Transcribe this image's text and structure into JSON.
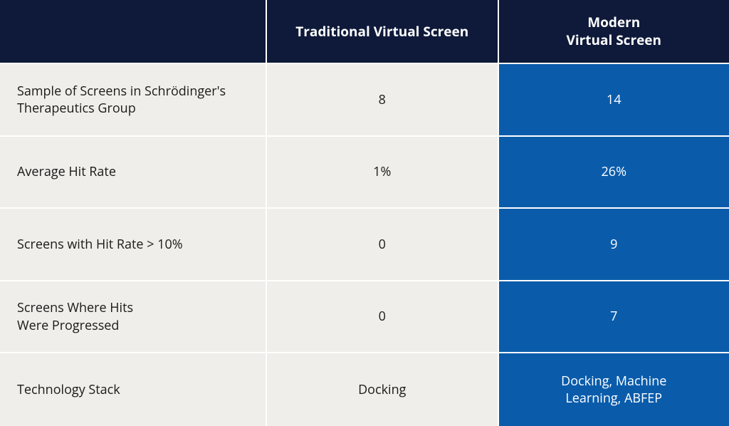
{
  "chart_data": {
    "type": "table",
    "columns": [
      "",
      "Traditional Virtual Screen",
      "Modern\nVirtual Screen"
    ],
    "rows": [
      {
        "label": "Sample of Screens in Schrödinger's Therapeutics Group",
        "traditional": "8",
        "modern": "14"
      },
      {
        "label": "Average Hit Rate",
        "traditional": "1%",
        "modern": "26%"
      },
      {
        "label": "Screens with Hit Rate > 10%",
        "traditional": "0",
        "modern": "9"
      },
      {
        "label": "Screens Where Hits\nWere Progressed",
        "traditional": "0",
        "modern": "7"
      },
      {
        "label": "Technology Stack",
        "traditional": "Docking",
        "modern": "Docking, Machine\nLearning, ABFEP"
      }
    ]
  },
  "headers": {
    "corner": "",
    "traditional": "Traditional Virtual Screen",
    "modern": "Modern\nVirtual Screen"
  },
  "rows": [
    {
      "label": "Sample of Screens in Schrödinger's Therapeutics Group",
      "traditional": "8",
      "modern": "14"
    },
    {
      "label": "Average Hit Rate",
      "traditional": "1%",
      "modern": "26%"
    },
    {
      "label": "Screens with Hit Rate > 10%",
      "traditional": "0",
      "modern": "9"
    },
    {
      "label": "Screens Where Hits\nWere Progressed",
      "traditional": "0",
      "modern": "7"
    },
    {
      "label": "Technology Stack",
      "traditional": "Docking",
      "modern": "Docking, Machine\nLearning, ABFEP"
    }
  ]
}
